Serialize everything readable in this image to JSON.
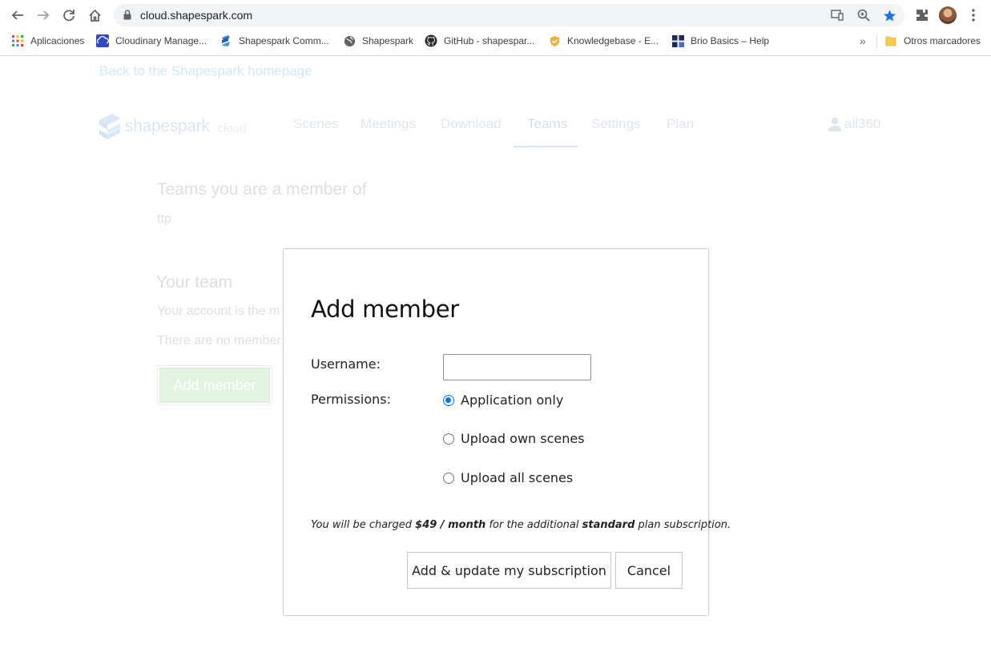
{
  "browser": {
    "url": "cloud.shapespark.com",
    "bookmarks": [
      {
        "label": "Aplicaciones",
        "icon": "apps-grid-icon"
      },
      {
        "label": "Cloudinary Manage...",
        "icon": "cloudinary-icon"
      },
      {
        "label": "Shapespark Comm...",
        "icon": "shapespark-icon"
      },
      {
        "label": "Shapespark",
        "icon": "globe-icon"
      },
      {
        "label": "GitHub - shapespar...",
        "icon": "github-icon"
      },
      {
        "label": "Knowledgebase - E...",
        "icon": "shield-badge-icon"
      },
      {
        "label": "Brio Basics – Help",
        "icon": "brio-icon"
      },
      {
        "label": "Otros marcadores",
        "icon": "folder-icon"
      }
    ],
    "more_bookmarks": "»"
  },
  "page": {
    "back_link": "Back to the Shapespark homepage",
    "logo_word": "shapespark",
    "logo_sub": "cloud",
    "nav": {
      "scenes": "Scenes",
      "meetings": "Meetings",
      "download": "Download",
      "teams": "Teams",
      "settings": "Settings",
      "plan": "Plan"
    },
    "active_tab": "Teams",
    "user": "all360",
    "teams_heading": "Teams you are a member of",
    "team_name": "ttp",
    "your_team_heading": "Your team",
    "owner_text": "Your account is the m",
    "no_members_text": "There are no member",
    "add_member_button": "Add member"
  },
  "modal": {
    "title": "Add member",
    "username_label": "Username:",
    "username_value": "",
    "permissions_label": "Permissions:",
    "permissions": [
      {
        "label": "Application only",
        "checked": true
      },
      {
        "label": "Upload own scenes",
        "checked": false
      },
      {
        "label": "Upload all scenes",
        "checked": false
      }
    ],
    "charge": {
      "prefix": "You will be charged ",
      "price": "$49",
      "sep": " / ",
      "period": "month",
      "middle": " for the additional ",
      "plan": "standard",
      "suffix": " plan subscription."
    },
    "add_button": "Add & update my subscription",
    "cancel_button": "Cancel"
  },
  "colors": {
    "accent": "#0075ff",
    "success": "#5cb85c"
  }
}
